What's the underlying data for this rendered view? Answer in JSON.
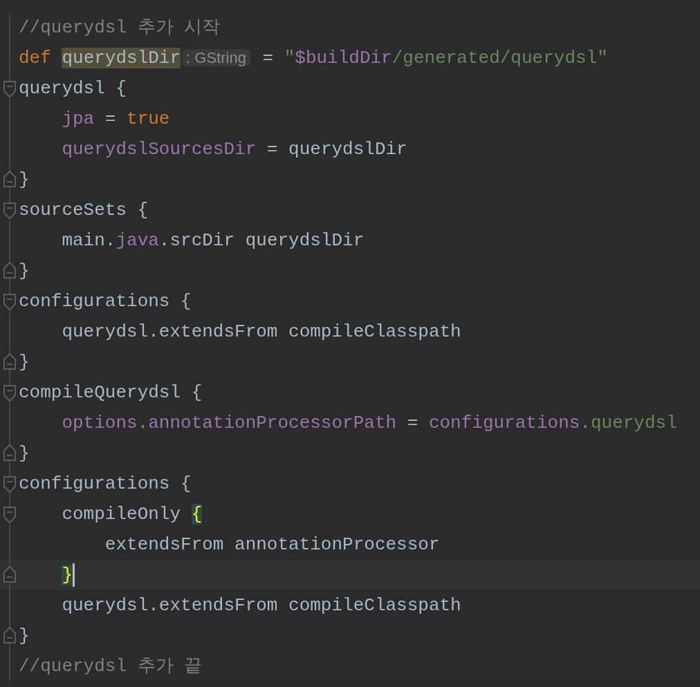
{
  "editor": {
    "lines": [
      {
        "kind": "plain",
        "current": false,
        "tokens": [
          {
            "kind": "comment",
            "text": "//querydsl 추가 시작"
          }
        ]
      },
      {
        "kind": "plain",
        "current": false,
        "tokens": [
          {
            "kind": "keyword",
            "text": "def "
          },
          {
            "kind": "highlight",
            "text": "querydslDir"
          },
          {
            "kind": "hint",
            "text": ": GString"
          },
          {
            "kind": "plain",
            "text": " = "
          },
          {
            "kind": "string",
            "text": "\""
          },
          {
            "kind": "property",
            "text": "$buildDir"
          },
          {
            "kind": "string",
            "text": "/generated/querydsl\""
          }
        ]
      },
      {
        "kind": "open",
        "current": false,
        "tokens": [
          {
            "kind": "plain",
            "text": "querydsl {"
          }
        ]
      },
      {
        "kind": "plain",
        "current": false,
        "tokens": [
          {
            "kind": "property",
            "text": "    jpa"
          },
          {
            "kind": "plain",
            "text": " = "
          },
          {
            "kind": "keyword",
            "text": "true"
          }
        ]
      },
      {
        "kind": "plain",
        "current": false,
        "tokens": [
          {
            "kind": "property",
            "text": "    querydslSourcesDir"
          },
          {
            "kind": "plain",
            "text": " = querydslDir"
          }
        ]
      },
      {
        "kind": "close",
        "current": false,
        "tokens": [
          {
            "kind": "plain",
            "text": "}"
          }
        ]
      },
      {
        "kind": "open",
        "current": false,
        "tokens": [
          {
            "kind": "plain",
            "text": "sourceSets {"
          }
        ]
      },
      {
        "kind": "plain",
        "current": false,
        "tokens": [
          {
            "kind": "plain",
            "text": "    main."
          },
          {
            "kind": "property",
            "text": "java"
          },
          {
            "kind": "plain",
            "text": ".srcDir querydslDir"
          }
        ]
      },
      {
        "kind": "close",
        "current": false,
        "tokens": [
          {
            "kind": "plain",
            "text": "}"
          }
        ]
      },
      {
        "kind": "open",
        "current": false,
        "tokens": [
          {
            "kind": "plain",
            "text": "configurations {"
          }
        ]
      },
      {
        "kind": "plain",
        "current": false,
        "tokens": [
          {
            "kind": "plain",
            "text": "    querydsl.extendsFrom compileClasspath"
          }
        ]
      },
      {
        "kind": "close",
        "current": false,
        "tokens": [
          {
            "kind": "plain",
            "text": "}"
          }
        ]
      },
      {
        "kind": "open",
        "current": false,
        "tokens": [
          {
            "kind": "plain",
            "text": "compileQuerydsl {"
          }
        ]
      },
      {
        "kind": "plain",
        "current": false,
        "tokens": [
          {
            "kind": "property",
            "text": "    options.annotationProcessorPath"
          },
          {
            "kind": "plain",
            "text": " = "
          },
          {
            "kind": "property",
            "text": "configurations."
          },
          {
            "kind": "string",
            "text": "querydsl"
          }
        ]
      },
      {
        "kind": "close",
        "current": false,
        "tokens": [
          {
            "kind": "plain",
            "text": "}"
          }
        ]
      },
      {
        "kind": "open",
        "current": false,
        "tokens": [
          {
            "kind": "plain",
            "text": "configurations {"
          }
        ]
      },
      {
        "kind": "open",
        "current": false,
        "tokens": [
          {
            "kind": "plain",
            "text": "    compileOnly "
          },
          {
            "kind": "brace",
            "text": "{"
          }
        ]
      },
      {
        "kind": "plain",
        "current": false,
        "tokens": [
          {
            "kind": "plain",
            "text": "        extendsFrom annotationProcessor"
          }
        ]
      },
      {
        "kind": "close",
        "current": true,
        "tokens": [
          {
            "kind": "indent",
            "text": "    }"
          }
        ]
      },
      {
        "kind": "plain",
        "current": false,
        "tokens": [
          {
            "kind": "plain",
            "text": "    querydsl.extendsFrom compileClasspath"
          }
        ]
      },
      {
        "kind": "close",
        "current": false,
        "tokens": [
          {
            "kind": "plain",
            "text": "}"
          }
        ]
      },
      {
        "kind": "plain",
        "current": false,
        "tokens": [
          {
            "kind": "comment",
            "text": "//querydsl 추가 끝"
          }
        ]
      }
    ]
  }
}
